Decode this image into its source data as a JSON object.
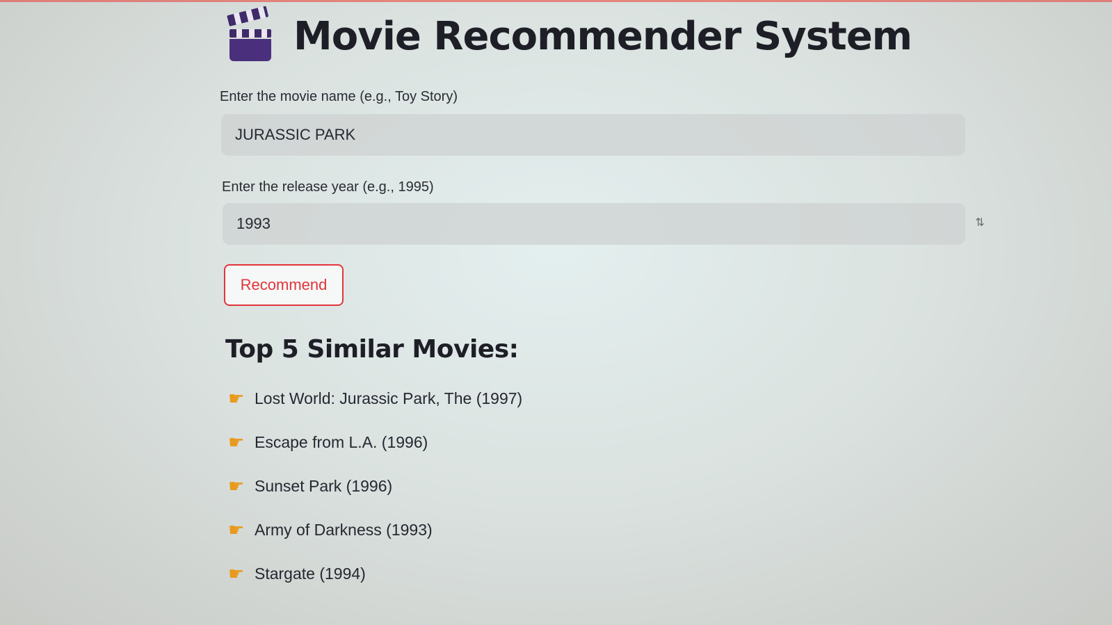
{
  "app": {
    "title": "Movie Recommender System",
    "title_icon": "clapperboard-icon"
  },
  "form": {
    "movie_label": "Enter the movie name (e.g., Toy Story)",
    "movie_value": "JURASSIC PARK",
    "year_label": "Enter the release year (e.g., 1995)",
    "year_value": "1993",
    "year_stepper_icon": "stepper-icon",
    "recommend_label": "Recommend"
  },
  "results": {
    "heading": "Top 5 Similar Movies:",
    "item_icon": "pointing-hand-icon",
    "items": [
      "Lost World: Jurassic Park, The (1997)",
      "Escape from L.A. (1996)",
      "Sunset Park (1996)",
      "Army of Darkness (1993)",
      "Stargate (1994)"
    ]
  },
  "colors": {
    "accent": "#e2353b",
    "icon": "#e89a1c",
    "clapper": "#4a2f7d"
  }
}
